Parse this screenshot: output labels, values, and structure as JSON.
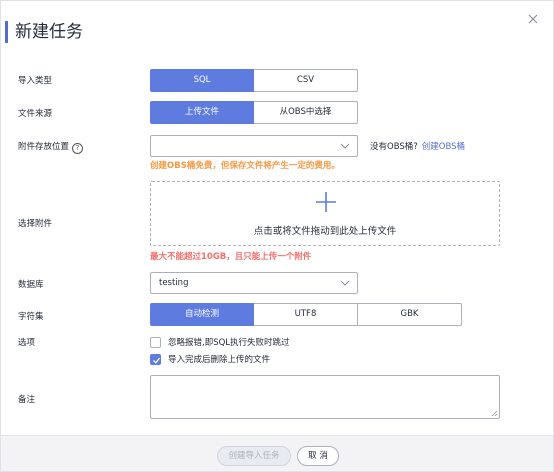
{
  "dialog": {
    "title": "新建任务",
    "close_icon": "close-icon"
  },
  "import_type": {
    "label": "导入类型",
    "options": [
      "SQL",
      "CSV"
    ],
    "selected": "SQL"
  },
  "file_source": {
    "label": "文件来源",
    "options": [
      "上传文件",
      "从OBS中选择"
    ],
    "selected": "上传文件"
  },
  "attachment_location": {
    "label": "附件存放位置",
    "help_icon": "?",
    "value": "",
    "no_bucket_text": "没有OBS桶?",
    "create_link": "创建OBS桶",
    "warning": "创建OBS桶免费，但保存文件将产生一定的费用。"
  },
  "attachment": {
    "label": "选择附件",
    "upload_text": "点击或将文件拖动到此处上传文件",
    "limit_warning": "最大不能超过10GB，且只能上传一个附件"
  },
  "database": {
    "label": "数据库",
    "value": "testing"
  },
  "charset": {
    "label": "字符集",
    "options": [
      "自动检测",
      "UTF8",
      "GBK"
    ],
    "selected": "自动检测"
  },
  "options": {
    "label": "选项",
    "items": [
      {
        "label": "忽略报错,即SQL执行失败时跳过",
        "checked": false
      },
      {
        "label": "导入完成后删除上传的文件",
        "checked": true
      }
    ]
  },
  "remark": {
    "label": "备注",
    "value": ""
  },
  "footer": {
    "submit_label": "创建导入任务",
    "cancel_label": "取 消"
  },
  "colors": {
    "accent": "#5e7ce0",
    "warning_red": "#f66f6a",
    "warning_orange": "#fa9841",
    "link": "#526ecc"
  }
}
